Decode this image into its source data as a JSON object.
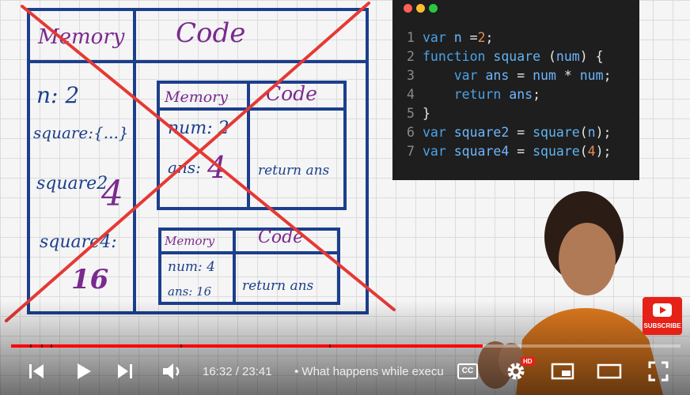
{
  "board": {
    "outer": {
      "memory_label": "Memory",
      "code_label": "Code",
      "entries": [
        {
          "text": "n: 2"
        },
        {
          "text": "square:{...}"
        },
        {
          "text": "square2"
        },
        {
          "text": "4"
        },
        {
          "text": "square4:"
        },
        {
          "text": "16"
        }
      ]
    },
    "ctx1": {
      "memory_label": "Memory",
      "code_label": "Code",
      "num": "num: 2",
      "ans_label": "ans:",
      "ans_value": "4",
      "code_text": "return ans"
    },
    "ctx2": {
      "memory_label": "Memory",
      "code_label": "Code",
      "num": "num: 4",
      "ans": "ans: 16",
      "code_text": "return ans"
    }
  },
  "code": {
    "lines": [
      {
        "n": "1",
        "parts": [
          [
            "kw",
            "var "
          ],
          [
            "var",
            "n "
          ],
          [
            "op",
            "="
          ],
          [
            "num",
            "2"
          ],
          [
            "op",
            ";"
          ]
        ]
      },
      {
        "n": "2",
        "parts": [
          [
            "kw",
            "function "
          ],
          [
            "fn",
            "square "
          ],
          [
            "op",
            "("
          ],
          [
            "var",
            "num"
          ],
          [
            "op",
            ") {"
          ]
        ]
      },
      {
        "n": "3",
        "parts": [
          [
            "op",
            "    "
          ],
          [
            "kw",
            "var "
          ],
          [
            "var",
            "ans "
          ],
          [
            "op",
            "= "
          ],
          [
            "var",
            "num "
          ],
          [
            "op",
            "* "
          ],
          [
            "var",
            "num"
          ],
          [
            "op",
            ";"
          ]
        ]
      },
      {
        "n": "4",
        "parts": [
          [
            "op",
            "    "
          ],
          [
            "kw",
            "return "
          ],
          [
            "var",
            "ans"
          ],
          [
            "op",
            ";"
          ]
        ]
      },
      {
        "n": "5",
        "parts": [
          [
            "op",
            "}"
          ]
        ]
      },
      {
        "n": "6",
        "parts": [
          [
            "kw",
            "var "
          ],
          [
            "var",
            "square2 "
          ],
          [
            "op",
            "= "
          ],
          [
            "fn",
            "square"
          ],
          [
            "op",
            "("
          ],
          [
            "var",
            "n"
          ],
          [
            "op",
            ");"
          ]
        ]
      },
      {
        "n": "7",
        "parts": [
          [
            "kw",
            "var "
          ],
          [
            "var",
            "square4 "
          ],
          [
            "op",
            "= "
          ],
          [
            "fn",
            "square"
          ],
          [
            "op",
            "("
          ],
          [
            "num",
            "4"
          ],
          [
            "op",
            ");"
          ]
        ]
      }
    ],
    "dot_colors": [
      "#ff5f57",
      "#febc2e",
      "#28c840"
    ]
  },
  "player": {
    "time_current": "16:32",
    "time_total": "23:41",
    "time_text": "16:32 / 23:41",
    "title": "• What happens while execu",
    "progress": 0.705,
    "subscribe_label": "SUBSCRIBE",
    "hd_badge": "HD",
    "cc_label": "CC",
    "colors": {
      "played": "#ff0000",
      "cross": "#e53935"
    }
  }
}
